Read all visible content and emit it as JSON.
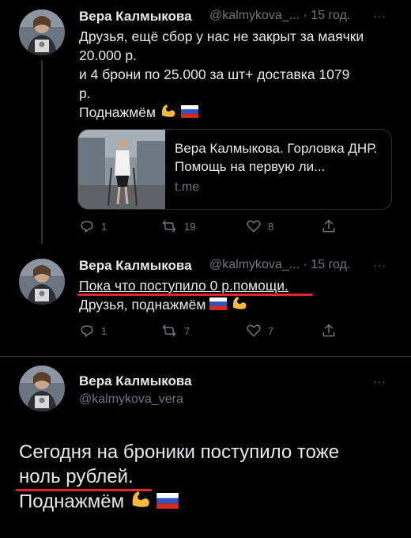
{
  "tweet1": {
    "author": "Вера Калмыкова",
    "handle": "@kalmykova_...",
    "dot": "·",
    "time": "15 год.",
    "more": "···",
    "line1": "Друзья, ещё сбор у нас не закрыт за маячки",
    "line2": "20.000 р.",
    "line3": "и 4 брони по 25.000 за шт+ доставка 1079",
    "line4": "р.",
    "line5": "Поднажмём",
    "card": {
      "title": "Вера Калмыкова. Горловка ДНР. Помощь на первую ли...",
      "domain": "t.me"
    },
    "actions": {
      "replies": "1",
      "retweets": "19",
      "likes": "8"
    }
  },
  "tweet2": {
    "author": "Вера Калмыкова",
    "handle": "@kalmykova_...",
    "dot": "·",
    "time": "15 год.",
    "more": "···",
    "line1": "Пока что поступило 0 р.помощи.",
    "line2": "Друзья, поднажмём",
    "actions": {
      "replies": "1",
      "retweets": "7",
      "likes": "7"
    }
  },
  "tweet3": {
    "author": "Вера Калмыкова",
    "handle": "@kalmykova_vera",
    "more": "···",
    "line1": "Сегодня на броники  поступило тоже",
    "line2": "ноль рублей.",
    "line3": "Поднажмём"
  },
  "colors": {
    "background": "#000000",
    "text": "#e7e9ea",
    "secondary": "#71767b",
    "highlight_underline": "#e3262b"
  },
  "icons": [
    "reply-icon",
    "retweet-icon",
    "like-icon",
    "share-icon",
    "flexed-biceps-emoji",
    "russia-flag-emoji"
  ]
}
